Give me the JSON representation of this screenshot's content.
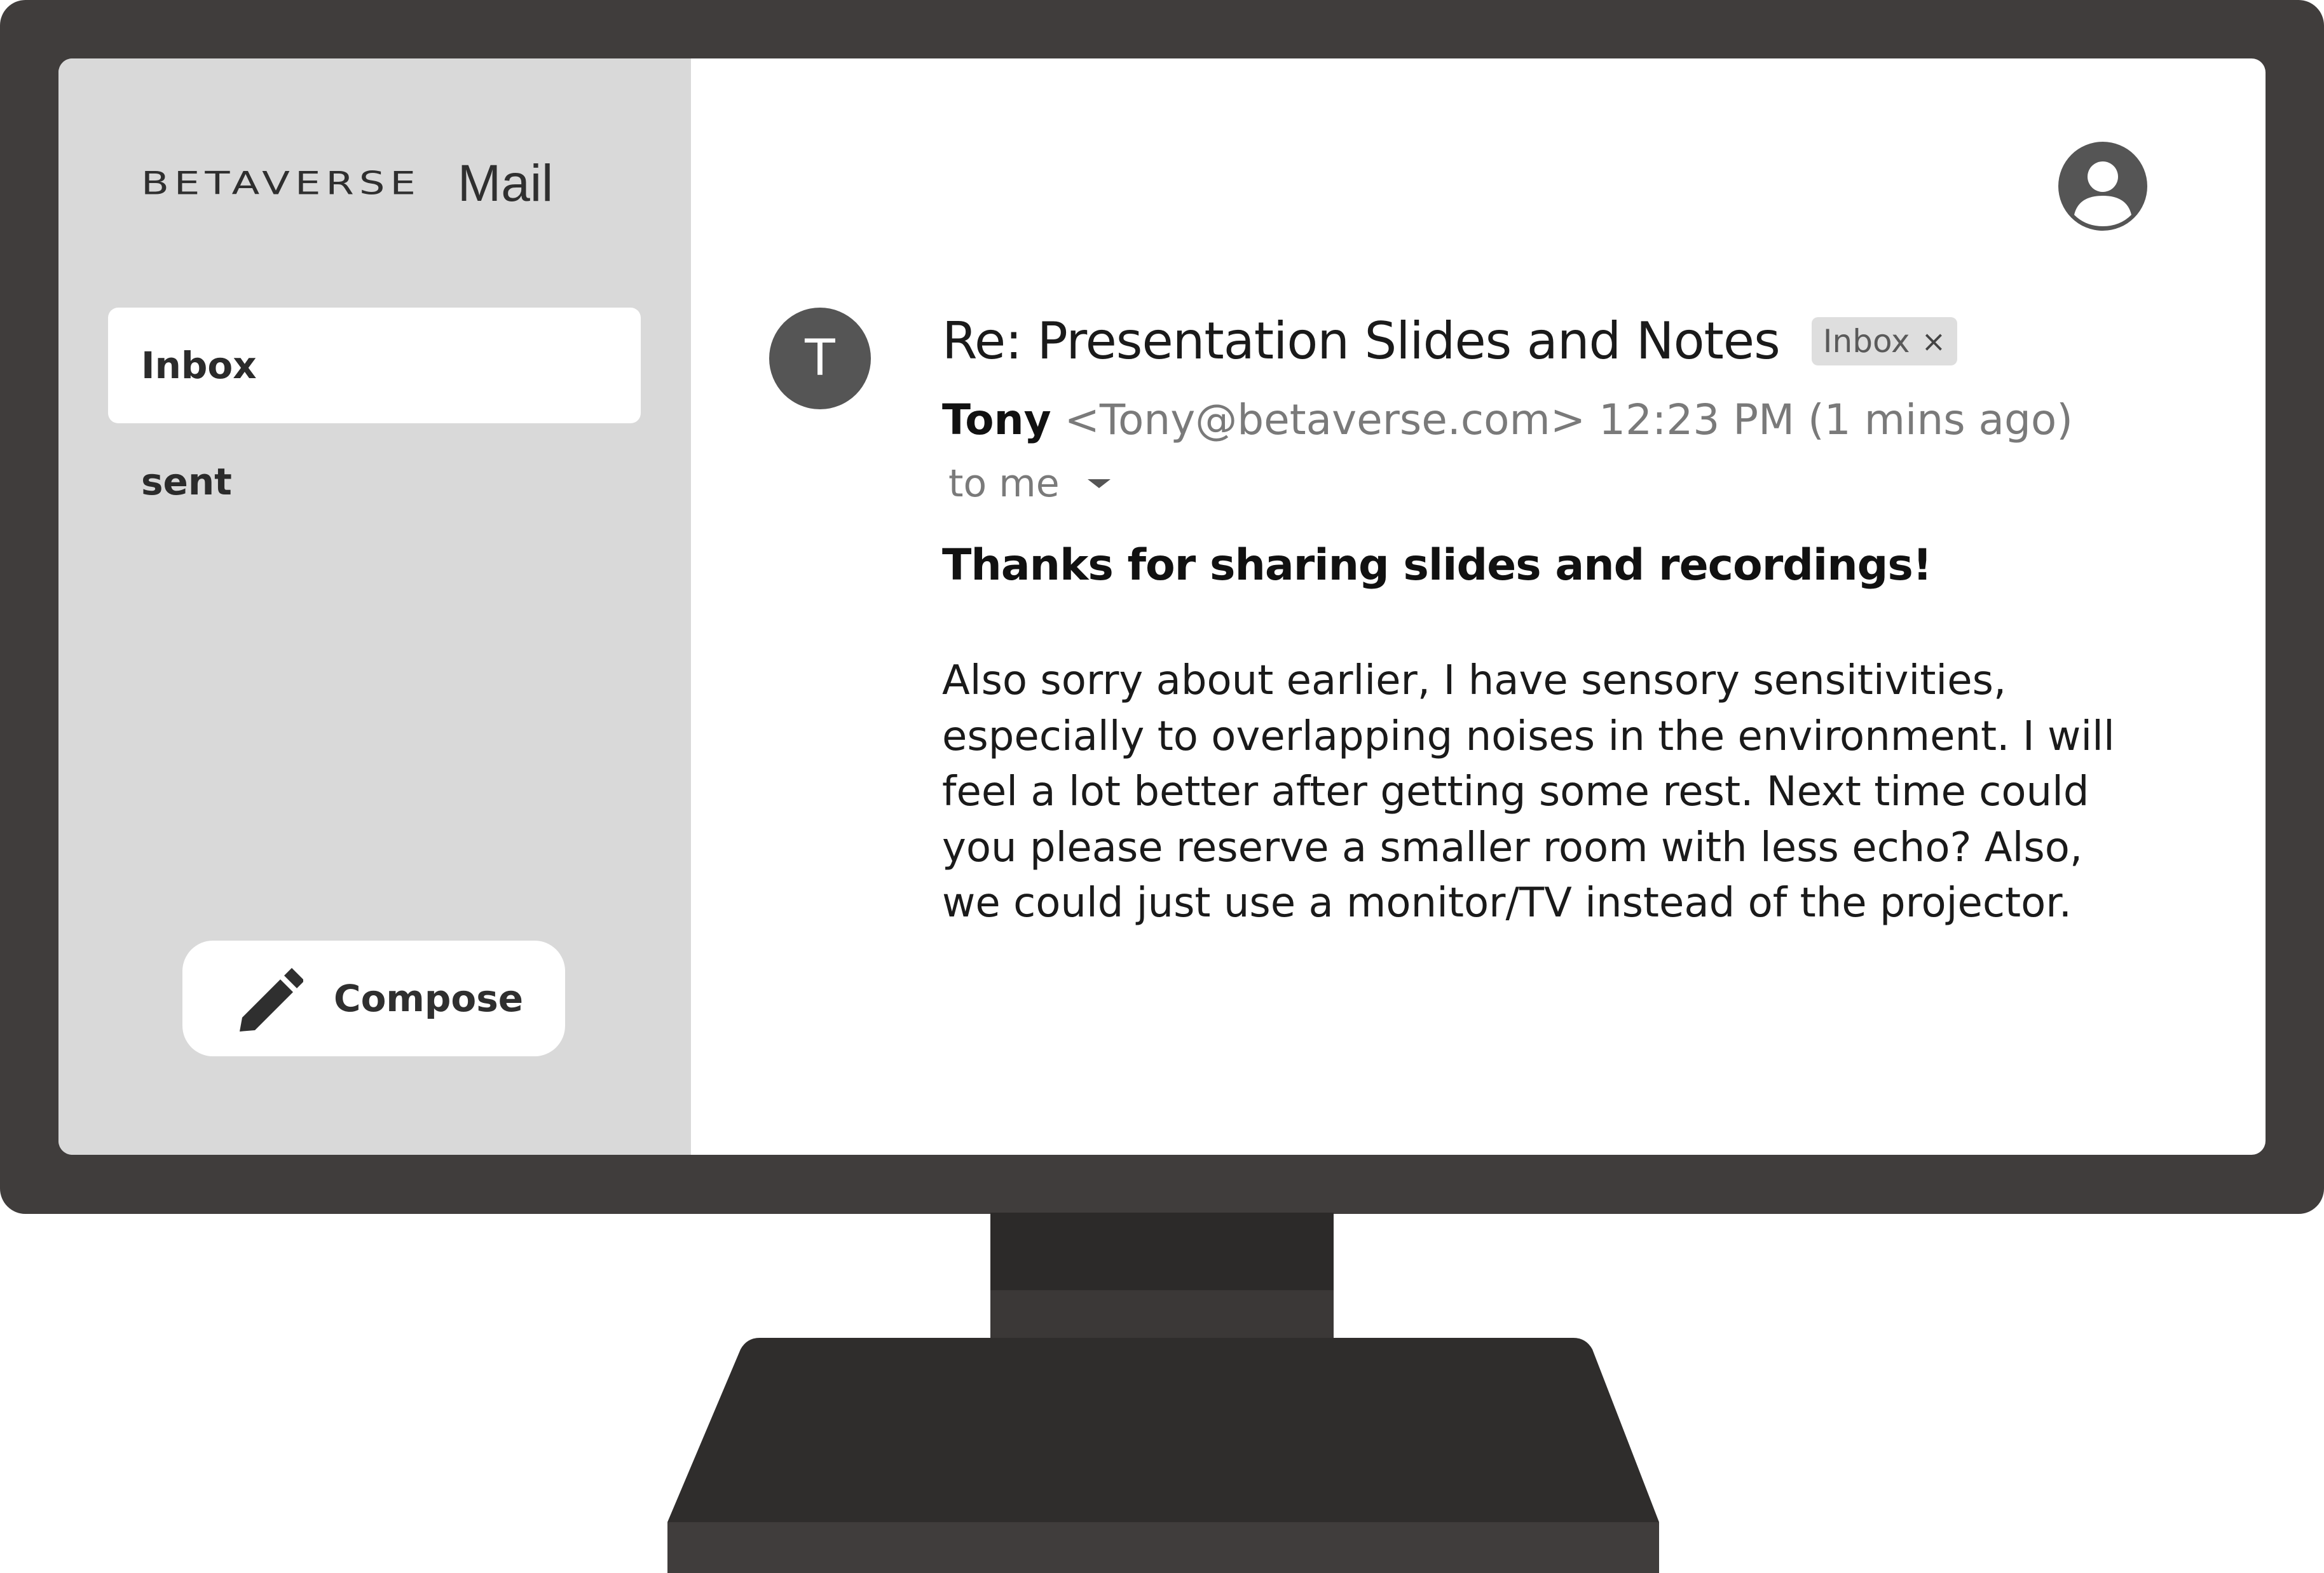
{
  "sidebar": {
    "brand_name": "BETAVERSE",
    "brand_suffix": "Mail",
    "items": [
      {
        "label": "Inbox",
        "active": true
      },
      {
        "label": "sent",
        "active": false
      }
    ],
    "compose_label": "Compose"
  },
  "header": {
    "profile_icon": "user-account-icon"
  },
  "message": {
    "sender_initial": "T",
    "subject": "Re: Presentation Slides and Notes",
    "label_chip": "Inbox",
    "label_remove": "×",
    "sender_name": "Tony",
    "sender_email": "<Tony@betaverse.com>",
    "time": "12:23 PM (1 mins ago)",
    "recipient": "to me",
    "body_lead": "Thanks for sharing slides and recordings!",
    "body_lines": [
      "Also sorry about earlier, I have sensory sensitivities,",
      "especially to overlapping noises in the environment. I will",
      "feel a lot better after getting some rest. Next time could",
      "you please reserve a smaller room with less echo? Also,",
      "we could just use a monitor/TV instead of the projector."
    ]
  },
  "colors": {
    "bezel": "#403d3c",
    "sidebar": "#d9d9d9",
    "avatar": "#555555"
  }
}
